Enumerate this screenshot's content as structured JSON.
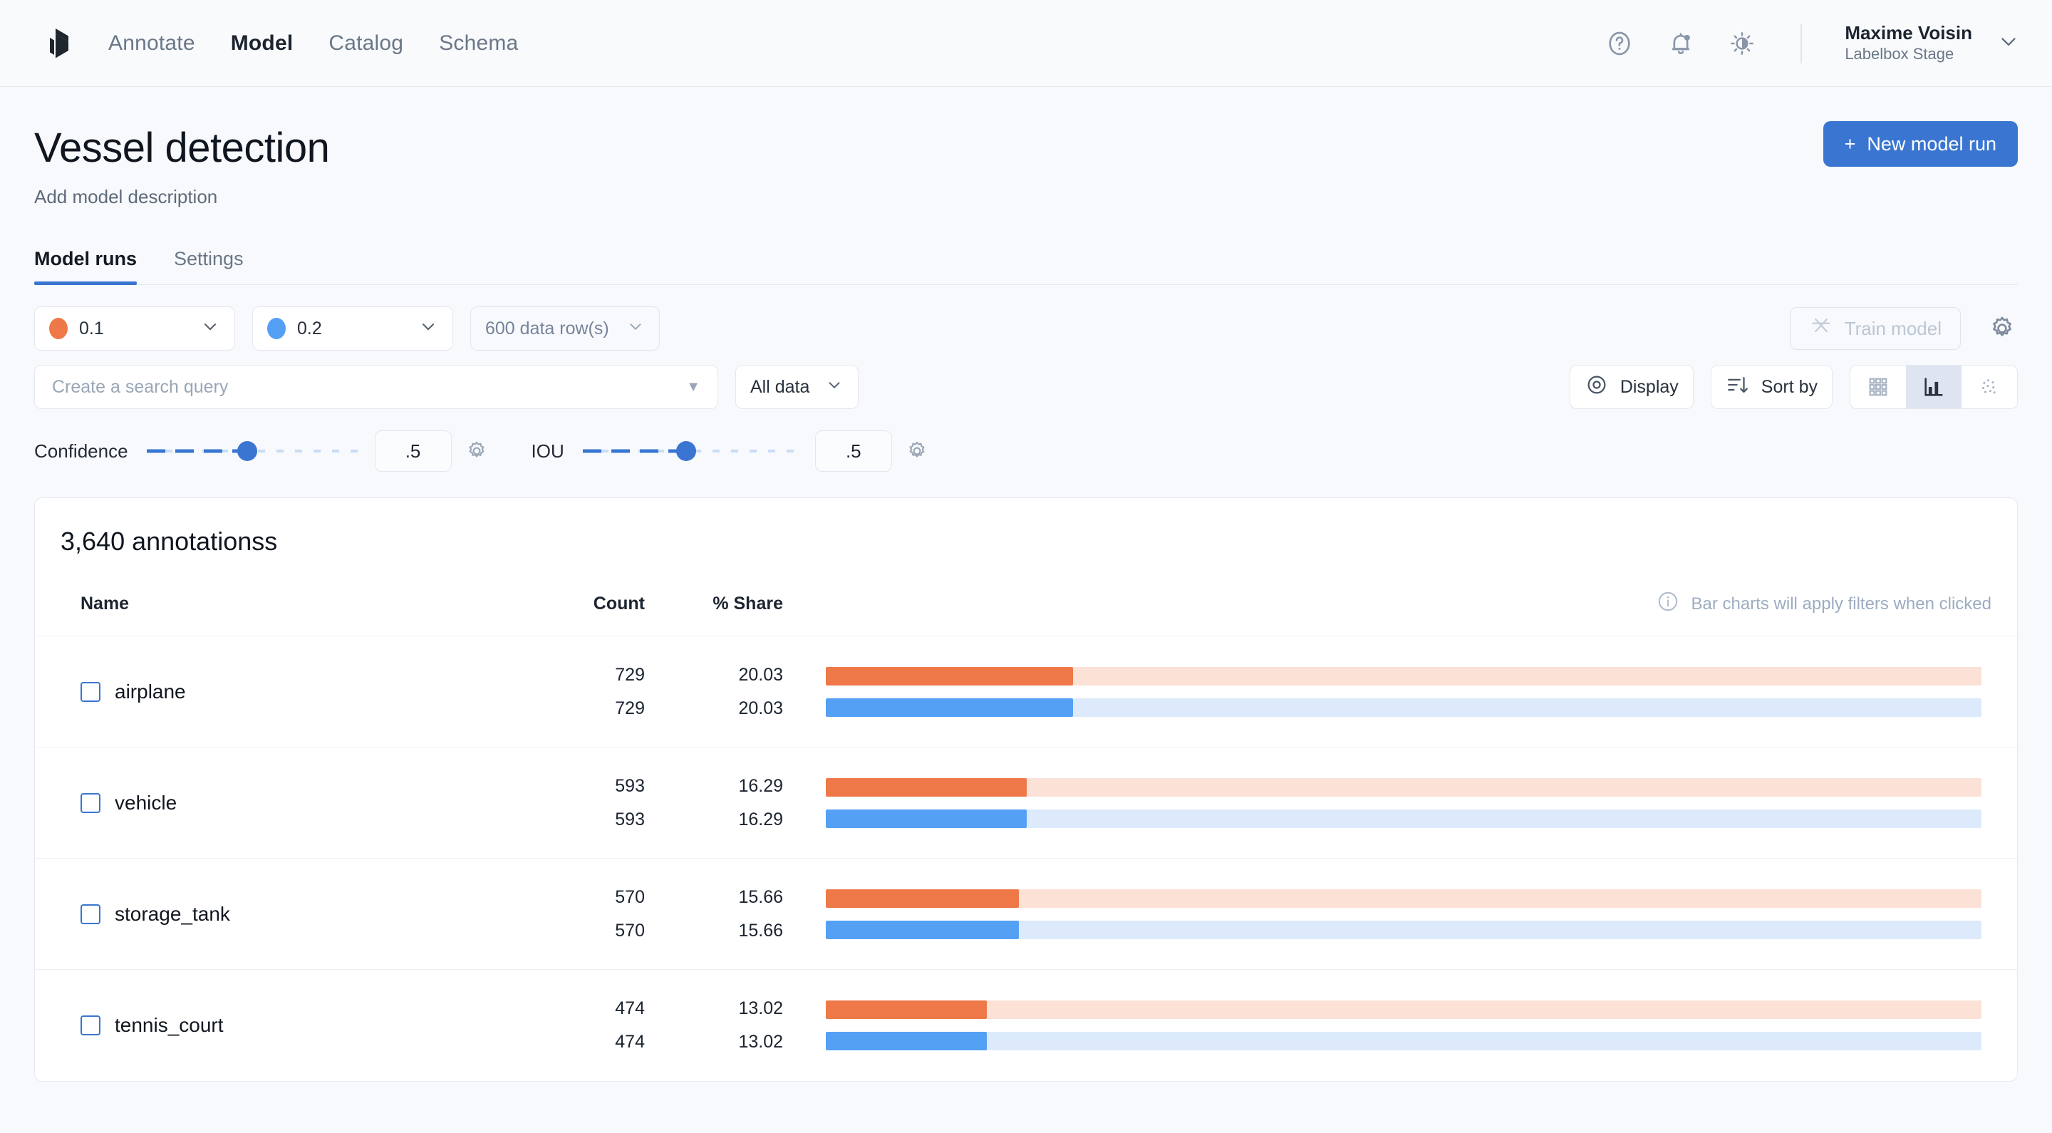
{
  "nav": {
    "logo_icon": "labelbox-cube-icon",
    "links": [
      {
        "label": "Annotate",
        "active": false
      },
      {
        "label": "Model",
        "active": true
      },
      {
        "label": "Catalog",
        "active": false
      },
      {
        "label": "Schema",
        "active": false
      }
    ],
    "icons": [
      "help-circle-icon",
      "bell-notification-icon",
      "brightness-icon"
    ],
    "user": {
      "name": "Maxime Voisin",
      "org": "Labelbox Stage",
      "chevron": "chevron-down-icon"
    }
  },
  "header": {
    "title": "Vessel detection",
    "subtitle": "Add model description",
    "new_run_label": "New model run",
    "new_run_plus": "+"
  },
  "tabs": [
    {
      "label": "Model runs",
      "active": true
    },
    {
      "label": "Settings",
      "active": false
    }
  ],
  "toolbar": {
    "run_a": {
      "value": "0.1",
      "color": "#ee7848"
    },
    "run_b": {
      "value": "0.2",
      "color": "#54a0f5"
    },
    "data_rows": "600 data row(s)",
    "train_model": "Train model",
    "train_icon": "train-model-icon",
    "settings_icon": "gear-icon"
  },
  "search": {
    "placeholder": "Create a search query",
    "value": "",
    "dropdown_icon": "caret-down-icon",
    "scope": "All data"
  },
  "view_controls": {
    "display": "Display",
    "display_icon": "eye-target-icon",
    "sort_by": "Sort by",
    "sort_icon": "sort-descending-icon",
    "segments": [
      {
        "icon": "grid-view-icon",
        "active": false
      },
      {
        "icon": "bar-chart-view-icon",
        "active": true
      },
      {
        "icon": "scatter-view-icon",
        "active": false
      }
    ]
  },
  "sliders": [
    {
      "label": "Confidence",
      "value": ".5",
      "fill_percent": 47,
      "gear_icon": "gear-icon"
    },
    {
      "label": "IOU",
      "value": ".5",
      "fill_percent": 47,
      "gear_icon": "gear-icon"
    }
  ],
  "annotations_card": {
    "title": "3,640 annotationss",
    "columns": {
      "name": "Name",
      "count": "Count",
      "share": "% Share"
    },
    "hint": "Bar charts will apply filters when clicked",
    "hint_icon": "info-circle-icon"
  },
  "chart_data": {
    "type": "bar",
    "title": "3,640 annotationss",
    "xlabel": "",
    "ylabel": "",
    "categories": [
      "airplane",
      "vehicle",
      "storage_tank",
      "tennis_court"
    ],
    "series": [
      {
        "name": "0.1",
        "color": "#ee7848",
        "track_color": "#fce1d6",
        "counts": [
          729,
          593,
          570,
          474
        ],
        "shares": [
          20.03,
          16.29,
          15.66,
          13.02
        ]
      },
      {
        "name": "0.2",
        "color": "#54a0f5",
        "track_color": "#dceafb",
        "counts": [
          729,
          593,
          570,
          474
        ],
        "shares": [
          20.03,
          16.29,
          15.66,
          13.02
        ]
      }
    ],
    "max_share": 20.03,
    "grid": false,
    "legend": "none"
  }
}
